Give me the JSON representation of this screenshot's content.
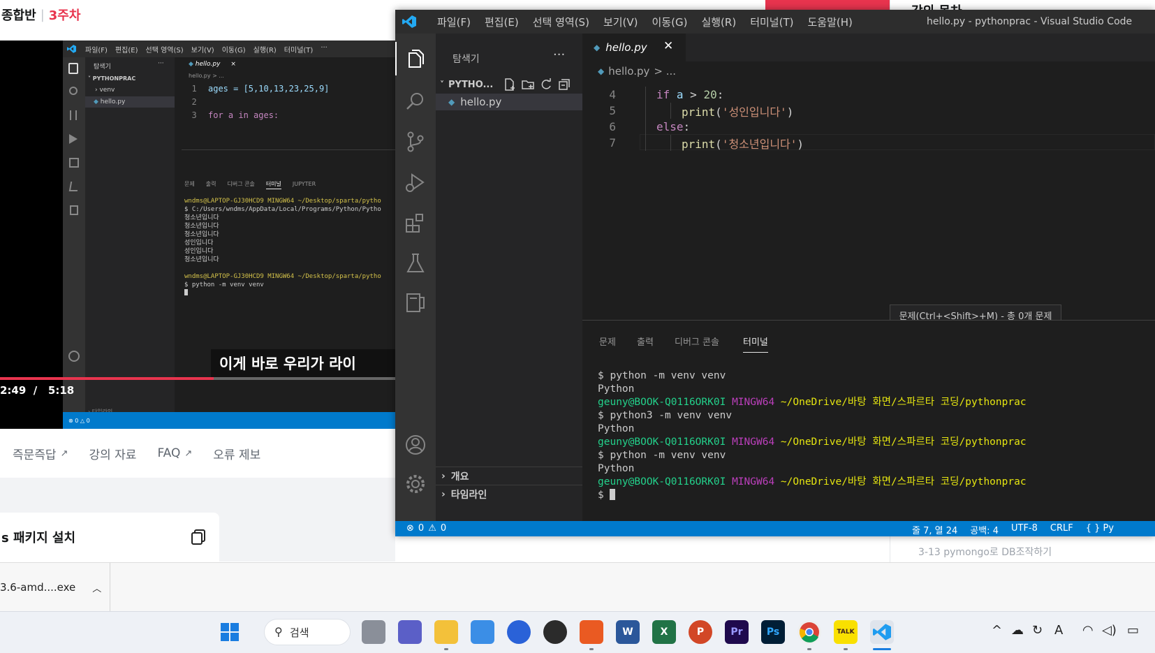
{
  "web": {
    "course_title": "종합반",
    "week": "3주차",
    "tabs": [
      {
        "label": "즉문즉답",
        "external": true
      },
      {
        "label": "강의 자료",
        "external": false
      },
      {
        "label": "FAQ",
        "external": true
      },
      {
        "label": "오류 제보",
        "external": false
      }
    ],
    "package_card": "s 패키지 설치",
    "right_title": "강의 목차",
    "right_row": "3-13   pymongo로 DB조작하기"
  },
  "video": {
    "current_time": "2:49",
    "duration": "5:18",
    "progress": 0.54,
    "subtitle": "이게 바로 우리가 라이"
  },
  "mini_vscode": {
    "menu": [
      "파일(F)",
      "편집(E)",
      "선택 영역(S)",
      "보기(V)",
      "이동(G)",
      "실행(R)",
      "터미널(T)",
      "···"
    ],
    "explorer_title": "탐색기",
    "folder": "PYTHONPRAC",
    "items": [
      "venv",
      "hello.py"
    ],
    "tab": "hello.py",
    "breadcrumb": "hello.py > ...",
    "code": [
      "ages = [5,10,13,23,25,9]",
      "",
      "for a in ages:"
    ],
    "panel_tabs": [
      "문제",
      "출력",
      "디버그 콘솔",
      "터미널",
      "JUPYTER"
    ],
    "term_lines": [
      "wndms@LAPTOP-GJ30HCD9 MINGW64 ~/Desktop/sparta/pytho",
      "$ C:/Users/wndms/AppData/Local/Programs/Python/Pytho",
      "청소년입니다",
      "청소년입니다",
      "청소년입니다",
      "성인입니다",
      "성인입니다",
      "청소년입니다",
      "",
      "wndms@LAPTOP-GJ30HCD9 MINGW64 ~/Desktop/sparta/pytho",
      "$ python -m venv venv"
    ],
    "section": "타임라인",
    "status": "⊗ 0 △ 0"
  },
  "vscode": {
    "window_title": "hello.py - pythonprac - Visual Studio Code",
    "menu": [
      "파일(F)",
      "편집(E)",
      "선택 영역(S)",
      "보기(V)",
      "이동(G)",
      "실행(R)",
      "터미널(T)",
      "도움말(H)"
    ],
    "explorer_title": "탐색기",
    "folder": "PYTHO...",
    "file": "hello.py",
    "sections": [
      "개요",
      "타임라인"
    ],
    "tab": "hello.py",
    "breadcrumb_file": "hello.py",
    "breadcrumb_rest": "> ...",
    "code_lines": [
      {
        "n": "4",
        "indent": 1,
        "parts": [
          [
            "kw",
            "if"
          ],
          [
            "",
            " "
          ],
          [
            "var",
            "a"
          ],
          [
            "",
            " > "
          ],
          [
            "num",
            "20"
          ],
          [
            "",
            ":"
          ]
        ]
      },
      {
        "n": "5",
        "indent": 2,
        "parts": [
          [
            "fn",
            "print"
          ],
          [
            "",
            "("
          ],
          [
            "str",
            "'성인입니다'"
          ],
          [
            "",
            ")"
          ]
        ]
      },
      {
        "n": "6",
        "indent": 1,
        "parts": [
          [
            "kw",
            "else"
          ],
          [
            "",
            ":"
          ]
        ]
      },
      {
        "n": "7",
        "indent": 2,
        "parts": [
          [
            "fn",
            "print"
          ],
          [
            "",
            "("
          ],
          [
            "str",
            "'청소년입니다'"
          ],
          [
            "",
            ")"
          ]
        ]
      }
    ],
    "tooltip": "문제(Ctrl+<Shift>+M) - 총 0개 문제",
    "panel_tabs": [
      "문제",
      "출력",
      "디버그 콘솔",
      "터미널"
    ],
    "active_panel_tab": "터미널",
    "terminal": [
      {
        "type": "cmd",
        "text": "$ python -m venv venv"
      },
      {
        "type": "out",
        "text": "Python"
      },
      {
        "type": "prompt",
        "user": "geuny@BOOK-Q0116ORK0I",
        "host": "MINGW64",
        "path": "~/OneDrive/바탕 화면/스파르타 코딩/pythonprac"
      },
      {
        "type": "cmd",
        "text": "$ python3 -m venv venv"
      },
      {
        "type": "out",
        "text": "Python"
      },
      {
        "type": "prompt",
        "user": "geuny@BOOK-Q0116ORK0I",
        "host": "MINGW64",
        "path": "~/OneDrive/바탕 화면/스파르타 코딩/pythonprac"
      },
      {
        "type": "cmd",
        "text": "$ python -m venv venv"
      },
      {
        "type": "out",
        "text": "Python"
      },
      {
        "type": "prompt",
        "user": "geuny@BOOK-Q0116ORK0I",
        "host": "MINGW64",
        "path": "~/OneDrive/바탕 화면/스파르타 코딩/pythonprac"
      },
      {
        "type": "cursor",
        "text": "$ "
      }
    ],
    "status_errors": "0",
    "status_warnings": "0",
    "status_position": "줄 7, 열 24",
    "status_spaces": "공백: 4",
    "status_encoding": "UTF-8",
    "status_eol": "CRLF",
    "status_lang": "{ } Py"
  },
  "download": {
    "file": "3.6-amd....exe"
  },
  "taskbar": {
    "search_label": "검색"
  },
  "colors": {
    "accent": "#007acc",
    "brand_red": "#e8344e",
    "term_green": "#23d18b",
    "term_yellow": "#e5e510",
    "term_magenta": "#bc3fbc"
  }
}
